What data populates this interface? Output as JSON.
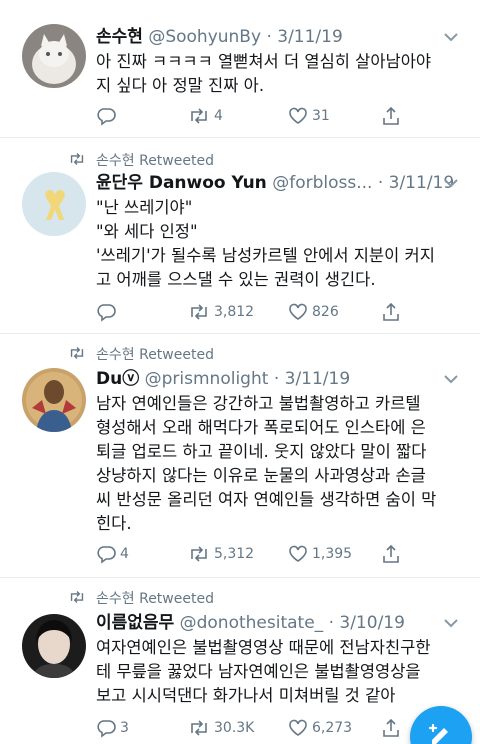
{
  "tweets": [
    {
      "retweeted_by": null,
      "name": "손수현",
      "handle": "@SoohyunBy",
      "date": "3/11/19",
      "lines": [
        "아 진짜 ㅋㅋㅋㅋ 열뻗쳐서 더 열심히 살아남아야",
        "지 싶다 아 정말 진짜 아."
      ],
      "reply_count": "",
      "retweet_count": "4",
      "like_count": "31"
    },
    {
      "retweeted_by": "손수현 Retweeted",
      "name": "윤단우 Danwoo Yun",
      "handle": "@forbloss...",
      "date": "3/11/19",
      "lines": [
        "\"난 쓰레기야\"",
        "\"와 세다 인정\"",
        "'쓰레기'가 될수록 남성카르텔 안에서 지분이 커지",
        "고 어깨를 으스댈 수 있는 권력이 생긴다."
      ],
      "reply_count": "",
      "retweet_count": "3,812",
      "like_count": "826"
    },
    {
      "retweeted_by": "손수현 Retweeted",
      "name": "Duⓥ",
      "handle": "@prismnolight",
      "date": "3/11/19",
      "lines": [
        "남자 연예인들은 강간하고 불법촬영하고 카르텔",
        "형성해서 오래 해먹다가 폭로되어도 인스타에 은",
        "퇴글 업로드 하고 끝이네. 웃지 않았다 말이 짧다",
        "상냥하지 않다는 이유로 눈물의 사과영상과 손글",
        "씨 반성문 올리던 여자 연예인들 생각하면 숨이 막",
        "힌다."
      ],
      "reply_count": "4",
      "retweet_count": "5,312",
      "like_count": "1,395"
    },
    {
      "retweeted_by": "손수현 Retweeted",
      "name": "이름없음무",
      "handle": "@donothesitate_",
      "date": "3/10/19",
      "lines": [
        "여자연예인은 불법촬영영상 때문에 전남자친구한",
        "테 무릎을 꿇었다 남자연예인은 불법촬영영상을",
        "보고 시시덕댄다 화가나서 미쳐버릴 것 같아"
      ],
      "reply_count": "3",
      "retweet_count": "30.3K",
      "like_count": "6,273"
    }
  ],
  "separator": "·",
  "icons": {
    "retweeted_marker": "retweet-icon",
    "reply": "reply-icon",
    "retweet": "retweet-icon",
    "like": "heart-icon",
    "share": "share-icon",
    "menu": "chevron-down-icon",
    "compose": "compose-tweet-icon"
  },
  "colors": {
    "accent": "#1da1f2",
    "secondary_text": "#657786",
    "divider": "#e6ecf0"
  }
}
